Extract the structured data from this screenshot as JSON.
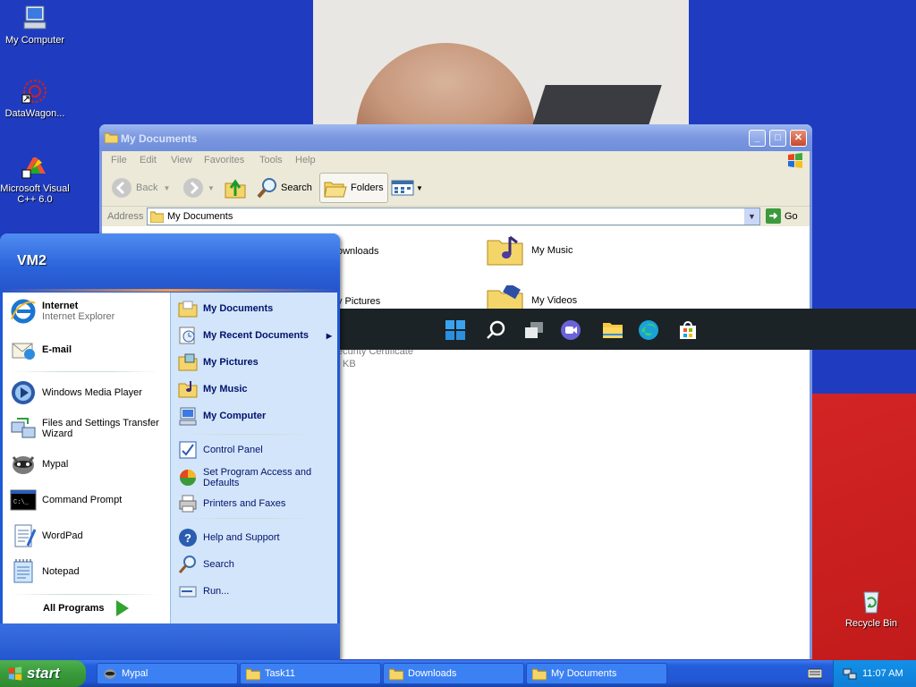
{
  "desktop": {
    "icons": [
      {
        "label": "My Computer"
      },
      {
        "label": "DataWagon..."
      },
      {
        "label": "Microsoft Visual C++ 6.0"
      },
      {
        "label": "Recycle Bin"
      }
    ]
  },
  "explorer": {
    "title": "My Documents",
    "menu": [
      "File",
      "Edit",
      "View",
      "Favorites",
      "Tools",
      "Help"
    ],
    "toolbar": {
      "back": "Back",
      "search": "Search",
      "folders": "Folders"
    },
    "address_label": "Address",
    "address_value": "My Documents",
    "go_label": "Go",
    "files": [
      {
        "name": "Downloads",
        "visible_name": "ownloads"
      },
      {
        "name": "My Music"
      },
      {
        "name": "My Pictures",
        "visible_name": "y Pictures"
      },
      {
        "name": "My Videos"
      },
      {
        "name": "Security Certificate",
        "visible_name": "ecurity Certificate",
        "size": "KB"
      }
    ]
  },
  "start_menu": {
    "user": "VM2",
    "pinned": [
      {
        "title": "Internet",
        "subtitle": "Internet Explorer"
      },
      {
        "title": "E-mail"
      }
    ],
    "recent": [
      {
        "label": "Windows Media Player"
      },
      {
        "label": "Files and Settings Transfer Wizard"
      },
      {
        "label": "Mypal"
      },
      {
        "label": "Command Prompt"
      },
      {
        "label": "WordPad"
      },
      {
        "label": "Notepad"
      }
    ],
    "all_programs": "All Programs",
    "right": [
      {
        "label": "My Documents"
      },
      {
        "label": "My Recent Documents"
      },
      {
        "label": "My Pictures"
      },
      {
        "label": "My Music"
      },
      {
        "label": "My Computer"
      },
      {
        "label": "Control Panel"
      },
      {
        "label": "Set Program Access and Defaults"
      },
      {
        "label": "Printers and Faxes"
      },
      {
        "label": "Help and Support"
      },
      {
        "label": "Search"
      },
      {
        "label": "Run..."
      }
    ]
  },
  "taskbar": {
    "start_label": "start",
    "tasks": [
      {
        "label": "Mypal"
      },
      {
        "label": "Task11"
      },
      {
        "label": "Downloads"
      },
      {
        "label": "My Documents"
      }
    ],
    "clock": "11:07 AM"
  },
  "colors": {
    "xp_blue": "#245edb",
    "start_green": "#3a9a3a",
    "start_menu_right": "#d3e5fa"
  }
}
